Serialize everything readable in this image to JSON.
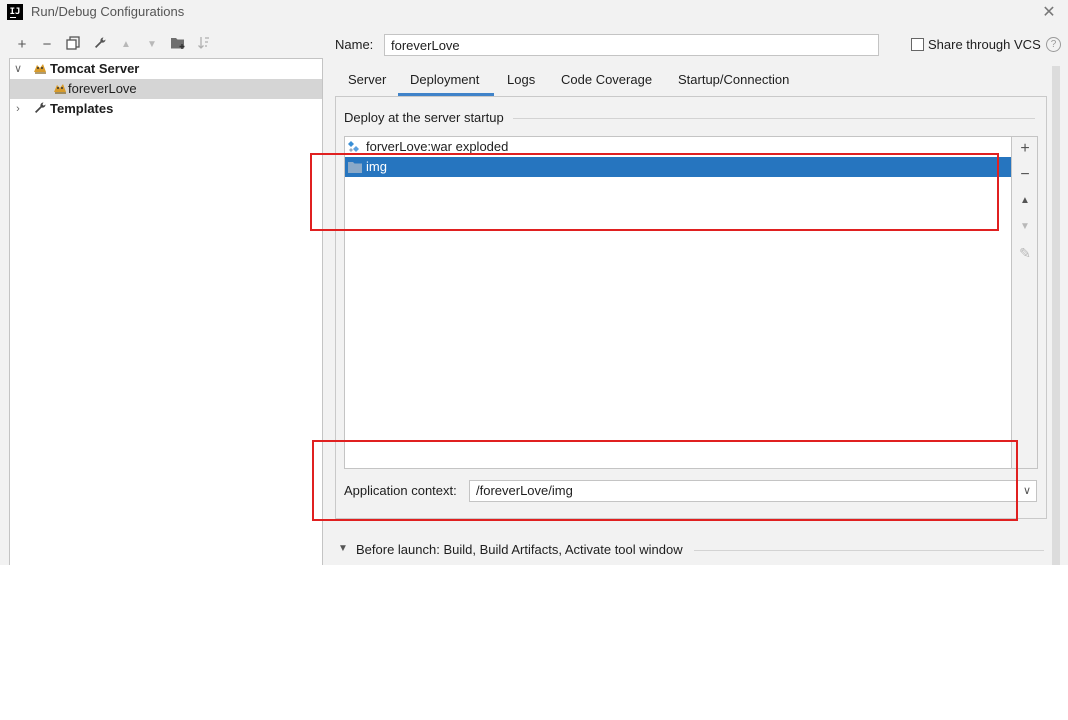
{
  "window": {
    "app_icon_text": "IJ",
    "title": "Run/Debug Configurations"
  },
  "toolbar": {
    "buttons": [
      {
        "name": "add",
        "glyph": "+"
      },
      {
        "name": "remove",
        "glyph": "−"
      },
      {
        "name": "copy",
        "glyph": "⧉"
      },
      {
        "name": "edit-defaults",
        "glyph": "🔧"
      },
      {
        "name": "move-up",
        "glyph": "▲"
      },
      {
        "name": "move-down",
        "glyph": "▼"
      },
      {
        "name": "new-folder",
        "glyph": "📁"
      },
      {
        "name": "sort",
        "glyph": "⇅"
      }
    ]
  },
  "tree": {
    "items": [
      {
        "label": "Tomcat Server",
        "expanded": true,
        "icon": "tomcat-icon"
      },
      {
        "label": "foreverLove",
        "icon": "tomcat-icon",
        "selected": true
      },
      {
        "label": "Templates",
        "expanded": false,
        "icon": "wrench-icon"
      }
    ]
  },
  "header": {
    "name_label": "Name:",
    "name_value": "foreverLove",
    "share_label": "Share through VCS",
    "share_checked": false
  },
  "tabs": [
    {
      "label": "Server"
    },
    {
      "label": "Deployment",
      "active": true
    },
    {
      "label": "Logs"
    },
    {
      "label": "Code Coverage"
    },
    {
      "label": "Startup/Connection"
    }
  ],
  "deployment": {
    "section_title": "Deploy at the server startup",
    "items": [
      {
        "label": "forverLove:war exploded",
        "icon": "artifact-icon"
      },
      {
        "label": "img",
        "icon": "folder-icon",
        "selected": true
      }
    ],
    "side_buttons": [
      "+",
      "−",
      "▲",
      "▼",
      "✎"
    ],
    "context_label": "Application context:",
    "context_value": "/foreverLove/img"
  },
  "before_launch": {
    "label": "Before launch: Build, Build Artifacts, Activate tool window"
  },
  "colors": {
    "selection_blue": "#2675bf",
    "tab_underline": "#4083c9",
    "annotation_red": "#e02020"
  }
}
